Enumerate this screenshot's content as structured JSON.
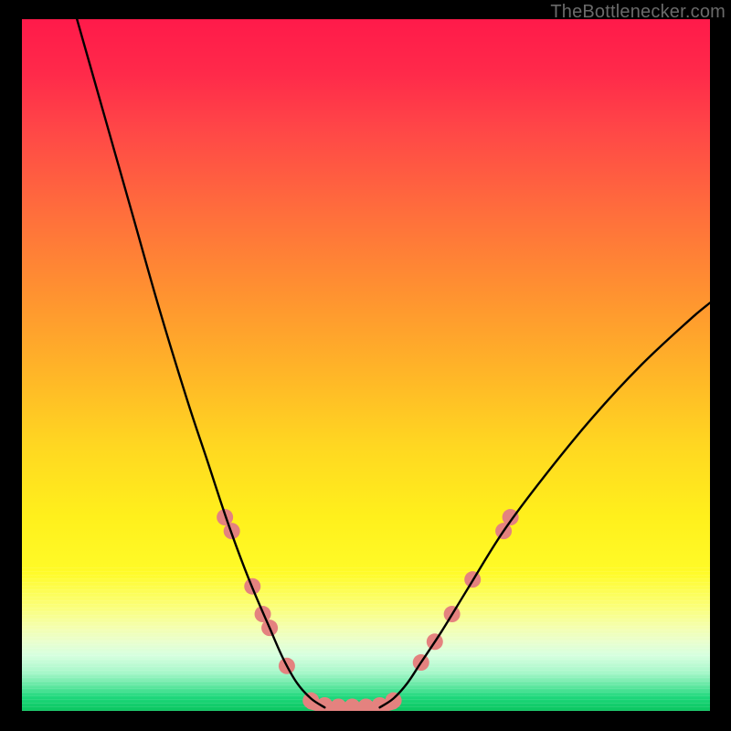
{
  "watermark": "TheBottlenecker.com",
  "chart_data": {
    "type": "line",
    "title": "",
    "xlabel": "",
    "ylabel": "",
    "xlim": [
      0,
      100
    ],
    "ylim": [
      0,
      100
    ],
    "background_gradient_stops": [
      {
        "pos": 0,
        "color": "#ff1a4a"
      },
      {
        "pos": 8,
        "color": "#ff2a4a"
      },
      {
        "pos": 16,
        "color": "#ff4747"
      },
      {
        "pos": 28,
        "color": "#ff6e3c"
      },
      {
        "pos": 40,
        "color": "#ff9330"
      },
      {
        "pos": 52,
        "color": "#ffb827"
      },
      {
        "pos": 62,
        "color": "#ffd821"
      },
      {
        "pos": 72,
        "color": "#fff01c"
      },
      {
        "pos": 80,
        "color": "#fffb28"
      },
      {
        "pos": 85,
        "color": "#fbff7a"
      },
      {
        "pos": 88,
        "color": "#f4ffb0"
      },
      {
        "pos": 90,
        "color": "#e9ffce"
      },
      {
        "pos": 92,
        "color": "#d6ffdf"
      },
      {
        "pos": 94.5,
        "color": "#a6f7c9"
      },
      {
        "pos": 96.5,
        "color": "#5de69f"
      },
      {
        "pos": 98,
        "color": "#1fd87c"
      },
      {
        "pos": 100,
        "color": "#0ac55f"
      }
    ],
    "series": [
      {
        "name": "left-curve",
        "color": "#000000",
        "x": [
          8.0,
          12.0,
          16.0,
          20.0,
          24.0,
          27.0,
          30.0,
          33.0,
          36.0,
          38.0,
          40.0,
          42.0,
          44.0
        ],
        "y": [
          100.0,
          86.0,
          72.0,
          58.0,
          45.0,
          36.0,
          27.0,
          19.0,
          12.0,
          7.5,
          4.0,
          1.8,
          0.5
        ]
      },
      {
        "name": "right-curve",
        "color": "#000000",
        "x": [
          52.0,
          54.0,
          56.0,
          58.0,
          61.0,
          65.0,
          70.0,
          76.0,
          83.0,
          90.0,
          97.0,
          100.0
        ],
        "y": [
          0.5,
          1.8,
          4.0,
          7.0,
          11.5,
          18.0,
          26.0,
          34.0,
          42.5,
          50.0,
          56.5,
          59.0
        ]
      },
      {
        "name": "floor",
        "color": "#e4827f",
        "x": [
          42.0,
          44.0,
          46.0,
          48.0,
          50.0,
          52.0,
          54.0
        ],
        "y": [
          1.0,
          0.5,
          0.3,
          0.3,
          0.3,
          0.5,
          1.0
        ]
      }
    ],
    "markers": {
      "name": "salmon-dots",
      "color": "#e4827f",
      "radius_px": 9,
      "points": [
        {
          "x": 29.5,
          "y": 28.0
        },
        {
          "x": 30.5,
          "y": 26.0
        },
        {
          "x": 33.5,
          "y": 18.0
        },
        {
          "x": 35.0,
          "y": 14.0
        },
        {
          "x": 36.0,
          "y": 12.0
        },
        {
          "x": 38.5,
          "y": 6.5
        },
        {
          "x": 42.0,
          "y": 1.5
        },
        {
          "x": 44.0,
          "y": 0.8
        },
        {
          "x": 46.0,
          "y": 0.6
        },
        {
          "x": 48.0,
          "y": 0.6
        },
        {
          "x": 50.0,
          "y": 0.6
        },
        {
          "x": 52.0,
          "y": 0.8
        },
        {
          "x": 54.0,
          "y": 1.5
        },
        {
          "x": 58.0,
          "y": 7.0
        },
        {
          "x": 60.0,
          "y": 10.0
        },
        {
          "x": 62.5,
          "y": 14.0
        },
        {
          "x": 65.5,
          "y": 19.0
        },
        {
          "x": 70.0,
          "y": 26.0
        },
        {
          "x": 71.0,
          "y": 28.0
        }
      ]
    }
  }
}
